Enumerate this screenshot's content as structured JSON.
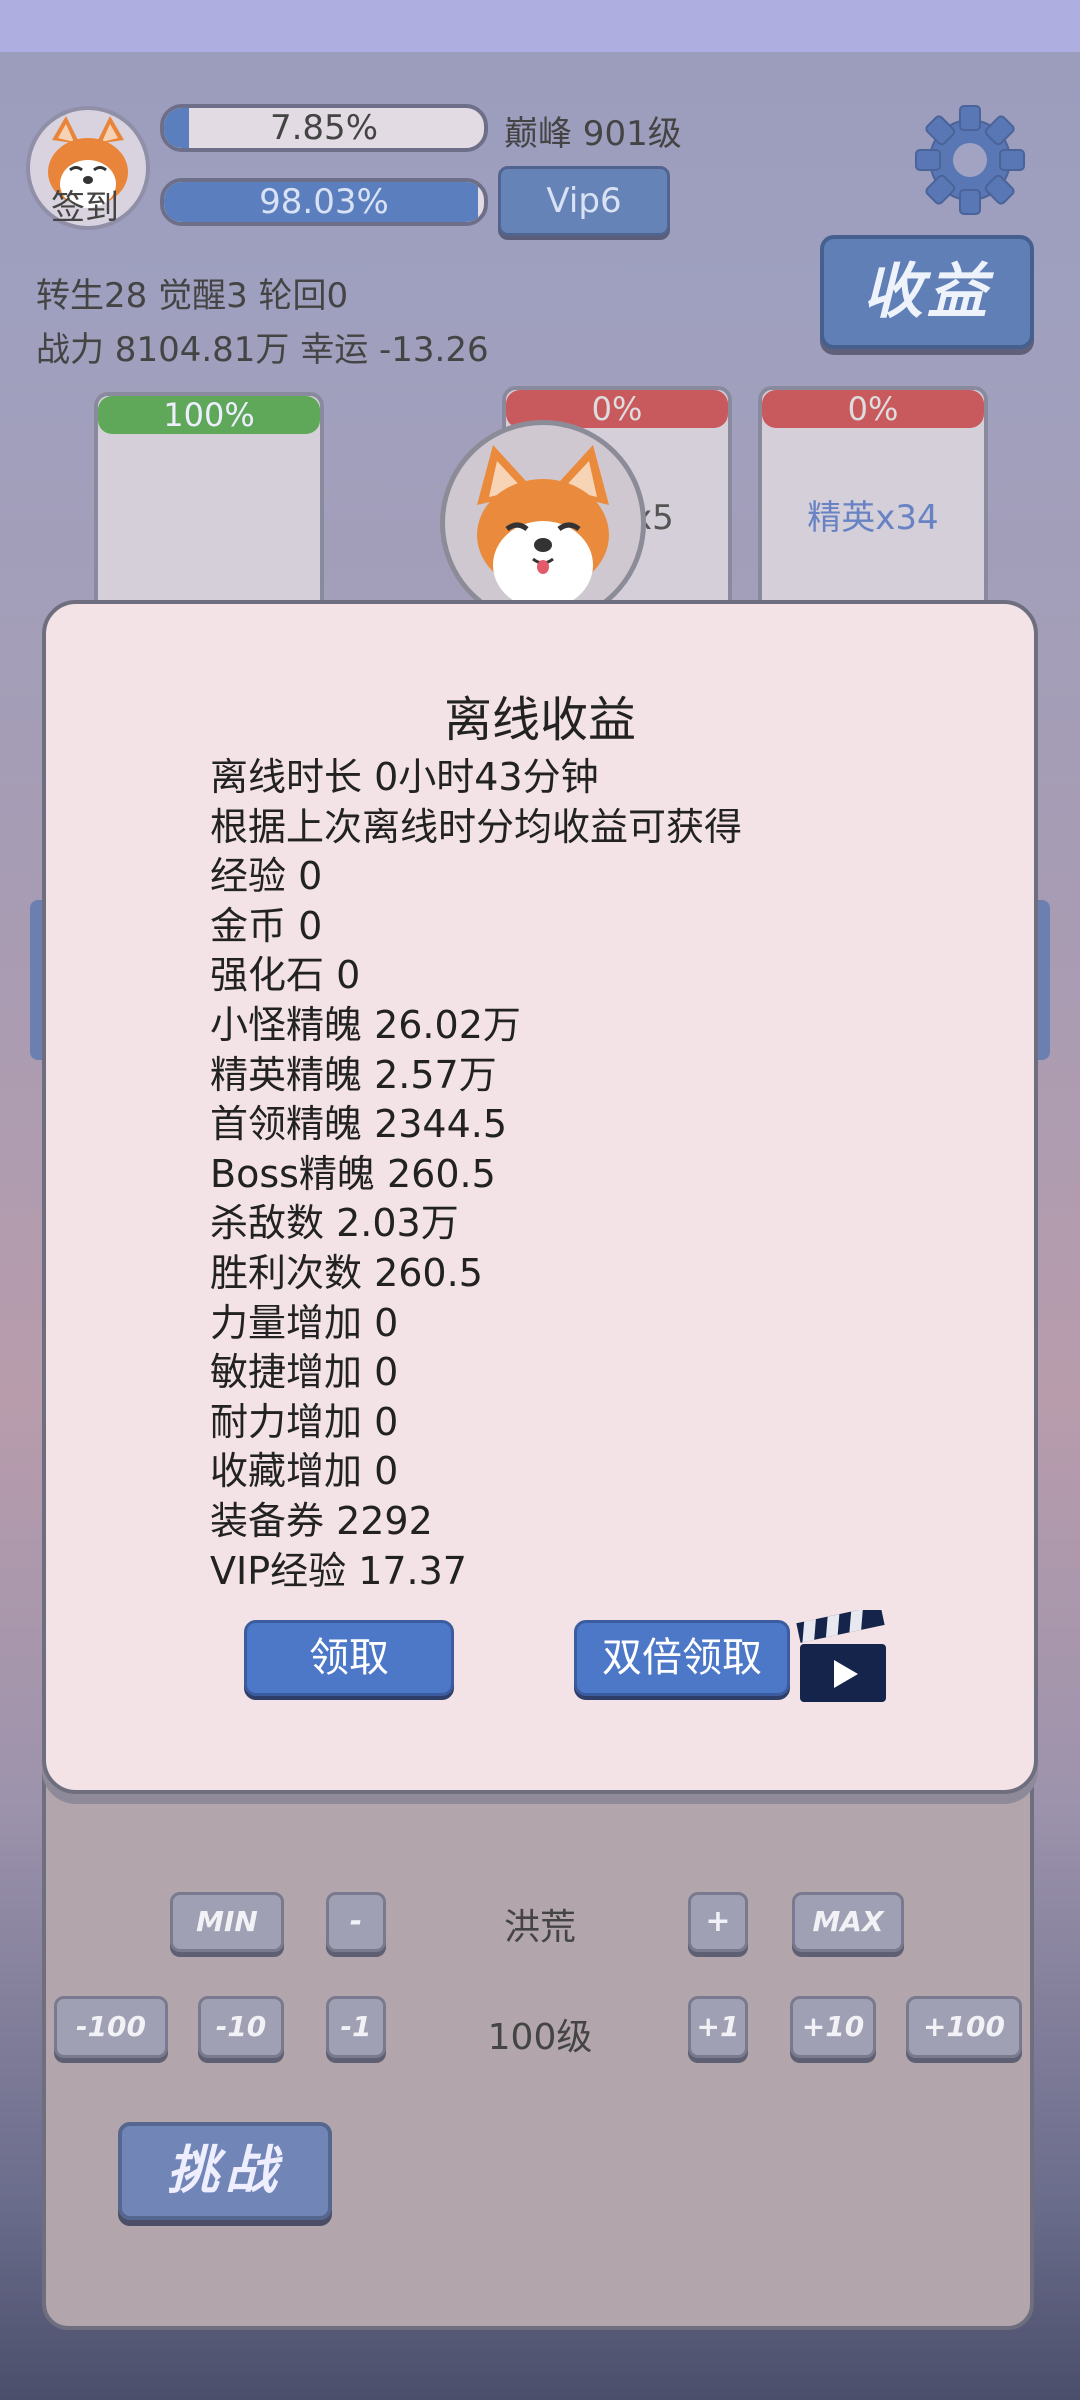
{
  "header": {
    "checkin_label": "签到",
    "exp_percent_label": "7.85%",
    "exp_progress": 0.0785,
    "vip_percent_label": "98.03%",
    "vip_progress": 0.9803,
    "level_label": "巅峰 901级",
    "vip_label": "Vip6",
    "rebirth_line": "转生28 觉醒3 轮回0",
    "power_line": "战力 8104.81万  幸运 -13.26",
    "income_button": "收益"
  },
  "cards": [
    {
      "percent": "100%",
      "label": "",
      "head_color": "#5fa85a"
    },
    {
      "percent": "0%",
      "label": "怪x5",
      "head_color": "#c85a5e"
    },
    {
      "percent": "0%",
      "label": "精英x34",
      "head_color": "#c85a5e"
    }
  ],
  "dialog": {
    "title": "离线收益",
    "lines": [
      "离线时长 0小时43分钟",
      "根据上次离线时分均收益可获得",
      "经验   0",
      "金币   0",
      "强化石  0",
      "小怪精魄 26.02万",
      "精英精魄 2.57万",
      "首领精魄 2344.5",
      "Boss精魄 260.5",
      "杀敌数  2.03万",
      "胜利次数 260.5",
      "力量增加 0",
      "敏捷增加 0",
      "耐力增加 0",
      "收藏增加 0",
      "装备券  2292",
      "VIP经验 17.37"
    ],
    "claim_button": "领取",
    "double_claim_button": "双倍领取",
    "video_icon": "clapperboard-icon"
  },
  "controls": {
    "min_label": "MIN",
    "minus_label": "-",
    "difficulty": "洪荒",
    "plus_label": "+",
    "max_label": "MAX",
    "m100": "-100",
    "m10": "-10",
    "m1": "-1",
    "level": "100级",
    "p1": "+1",
    "p10": "+10",
    "p100": "+100",
    "challenge_button": "挑战"
  }
}
